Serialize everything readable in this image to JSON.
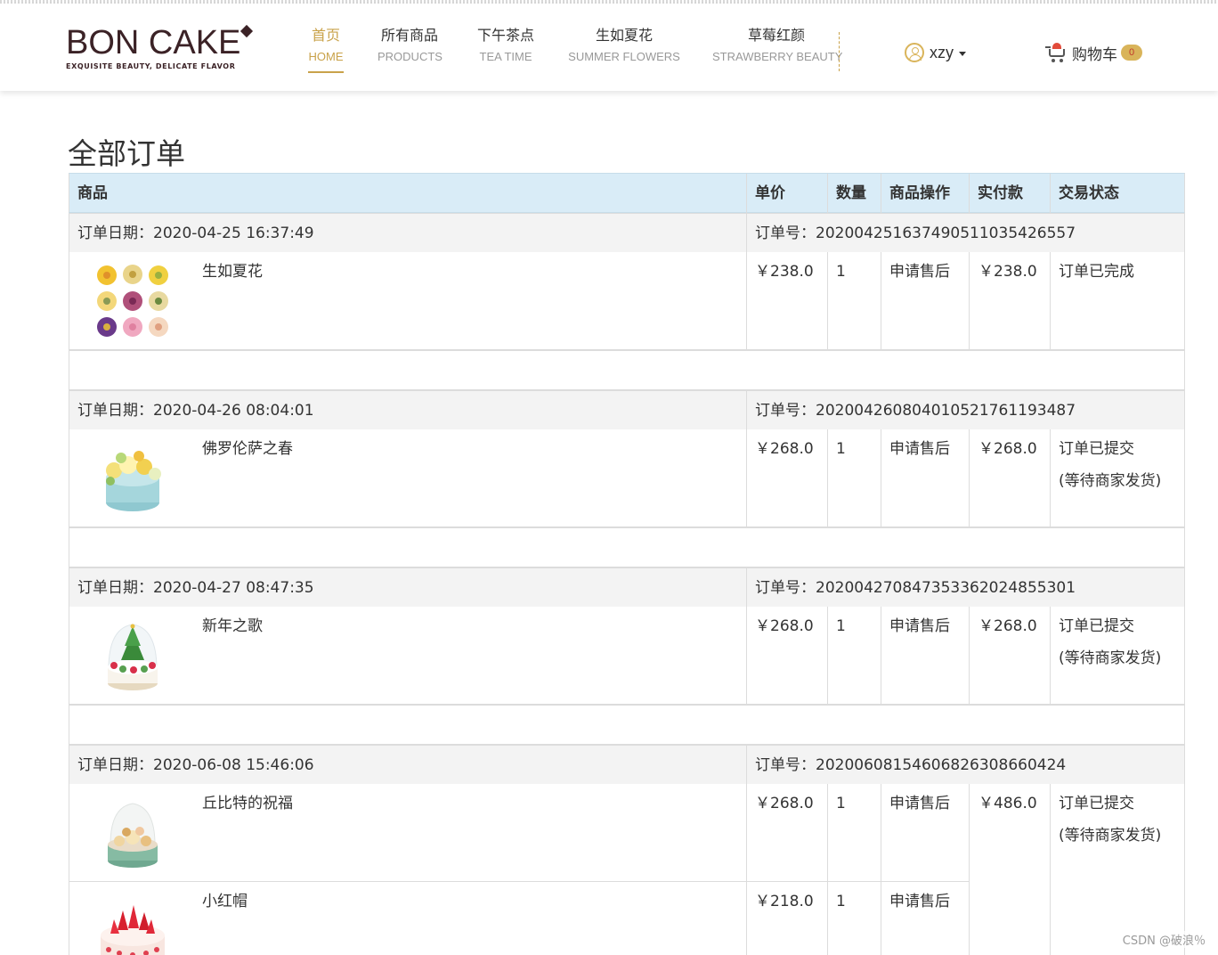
{
  "header": {
    "logo": {
      "title": "BON CAKE",
      "subtitle": "EXQUISITE BEAUTY, DELICATE FLAVOR"
    },
    "nav": [
      {
        "cn": "首页",
        "en": "HOME",
        "active": true
      },
      {
        "cn": "所有商品",
        "en": "PRODUCTS"
      },
      {
        "cn": "下午茶点",
        "en": "TEA TIME"
      },
      {
        "cn": "生如夏花",
        "en": "SUMMER FLOWERS"
      },
      {
        "cn": "草莓红颜",
        "en": "STRAWBERRY BEAUTY"
      }
    ],
    "user": {
      "name": "xzy",
      "icon": "user-icon"
    },
    "cart": {
      "label": "购物车",
      "count": "0",
      "icon": "cart-icon"
    },
    "accent_color": "#c9a24a"
  },
  "page": {
    "title": "全部订单",
    "table_header_bg": "#d9ecf7",
    "columns": [
      "商品",
      "单价",
      "数量",
      "商品操作",
      "实付款",
      "交易状态"
    ],
    "labels": {
      "date": "订单日期：",
      "order_no": "订单号："
    }
  },
  "orders": [
    {
      "date": "2020-04-25 16:37:49",
      "order_no": "202004251637490511035426557",
      "paid": "￥238.0",
      "status": [
        "订单已完成"
      ],
      "items": [
        {
          "name": "生如夏花",
          "price": "￥238.0",
          "qty": "1",
          "action": "申请售后",
          "image": "flower-cupcakes-image"
        }
      ]
    },
    {
      "date": "2020-04-26 08:04:01",
      "order_no": "202004260804010521761193487",
      "paid": "￥268.0",
      "status": [
        "订单已提交",
        "(等待商家发货)"
      ],
      "items": [
        {
          "name": "佛罗伦萨之春",
          "price": "￥268.0",
          "qty": "1",
          "action": "申请售后",
          "image": "flower-cake-image"
        }
      ]
    },
    {
      "date": "2020-04-27 08:47:35",
      "order_no": "202004270847353362024855301",
      "paid": "￥268.0",
      "status": [
        "订单已提交",
        "(等待商家发货)"
      ],
      "items": [
        {
          "name": "新年之歌",
          "price": "￥268.0",
          "qty": "1",
          "action": "申请售后",
          "image": "christmas-tree-cake-image"
        }
      ]
    },
    {
      "date": "2020-06-08 15:46:06",
      "order_no": "20200608154606826308660424",
      "paid": "￥486.0",
      "status": [
        "订单已提交",
        "(等待商家发货)"
      ],
      "items": [
        {
          "name": "丘比特的祝福",
          "price": "￥268.0",
          "qty": "1",
          "action": "申请售后",
          "image": "dome-cake-image"
        },
        {
          "name": "小红帽",
          "price": "￥218.0",
          "qty": "1",
          "action": "申请售后",
          "image": "strawberry-cake-image"
        }
      ]
    }
  ],
  "watermark": "CSDN @破浪％"
}
